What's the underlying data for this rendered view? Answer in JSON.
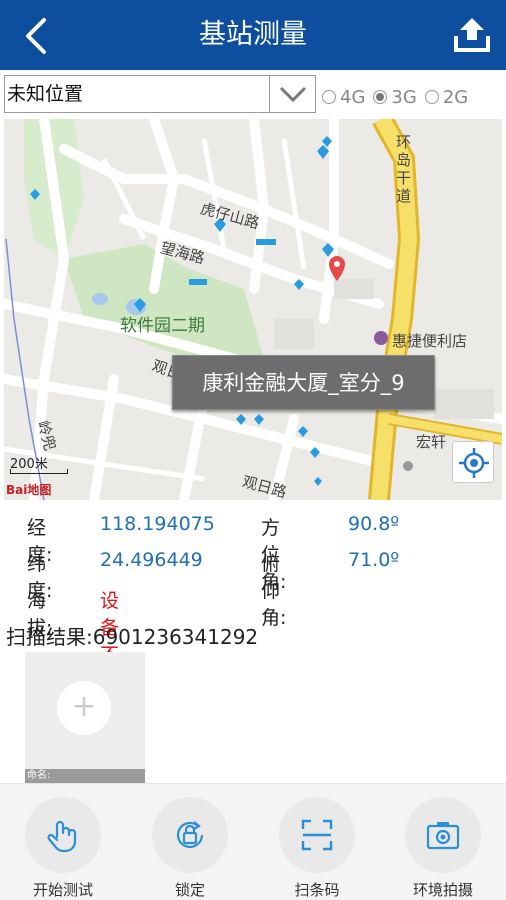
{
  "header": {
    "title": "基站测量",
    "back_icon": "back-arrow-icon",
    "upload_icon": "upload-icon"
  },
  "location_select": {
    "value": "未知位置"
  },
  "network": {
    "options": [
      "4G",
      "3G",
      "2G"
    ],
    "selected": "3G"
  },
  "map": {
    "labels": {
      "road1": "虎仔山路",
      "road2": "望海路",
      "park": "软件园二期",
      "shop": "惠捷便利店",
      "road3": "观日路",
      "road4": "观日路",
      "road5": "环岛干道",
      "poi": "宏轩",
      "road6": "岭兜",
      "cut_left": "观日"
    },
    "popup": "康利金融大厦_室分_9",
    "scale": "200米",
    "logo": "Bai地图"
  },
  "info": {
    "lon_label": "经  度:",
    "lon_value": "118.194075",
    "azimuth_label": "方位角:",
    "azimuth_value": "90.8º",
    "lat_label": "纬  度:",
    "lat_value": "24.496449",
    "pitch_label": "俯仰角:",
    "pitch_value": "71.0º",
    "alt_label": "海  拔:",
    "alt_value": "设备不支持"
  },
  "scan": {
    "text": "扫描结果:6901236341292"
  },
  "photo": {
    "name_label": "命名:"
  },
  "toolbar": {
    "items": [
      {
        "label": "开始测试",
        "icon": "hand-tap-icon"
      },
      {
        "label": "锁定",
        "icon": "lock-rotate-icon"
      },
      {
        "label": "扫条码",
        "icon": "scan-barcode-icon"
      },
      {
        "label": "环境拍摄",
        "icon": "camera-icon"
      }
    ]
  },
  "colors": {
    "header": "#0d4f9e",
    "accent_blue": "#1f6fb4",
    "warning_red": "#e01414",
    "road_yellow": "#f2d74b",
    "park_green": "#cfe6c2"
  }
}
